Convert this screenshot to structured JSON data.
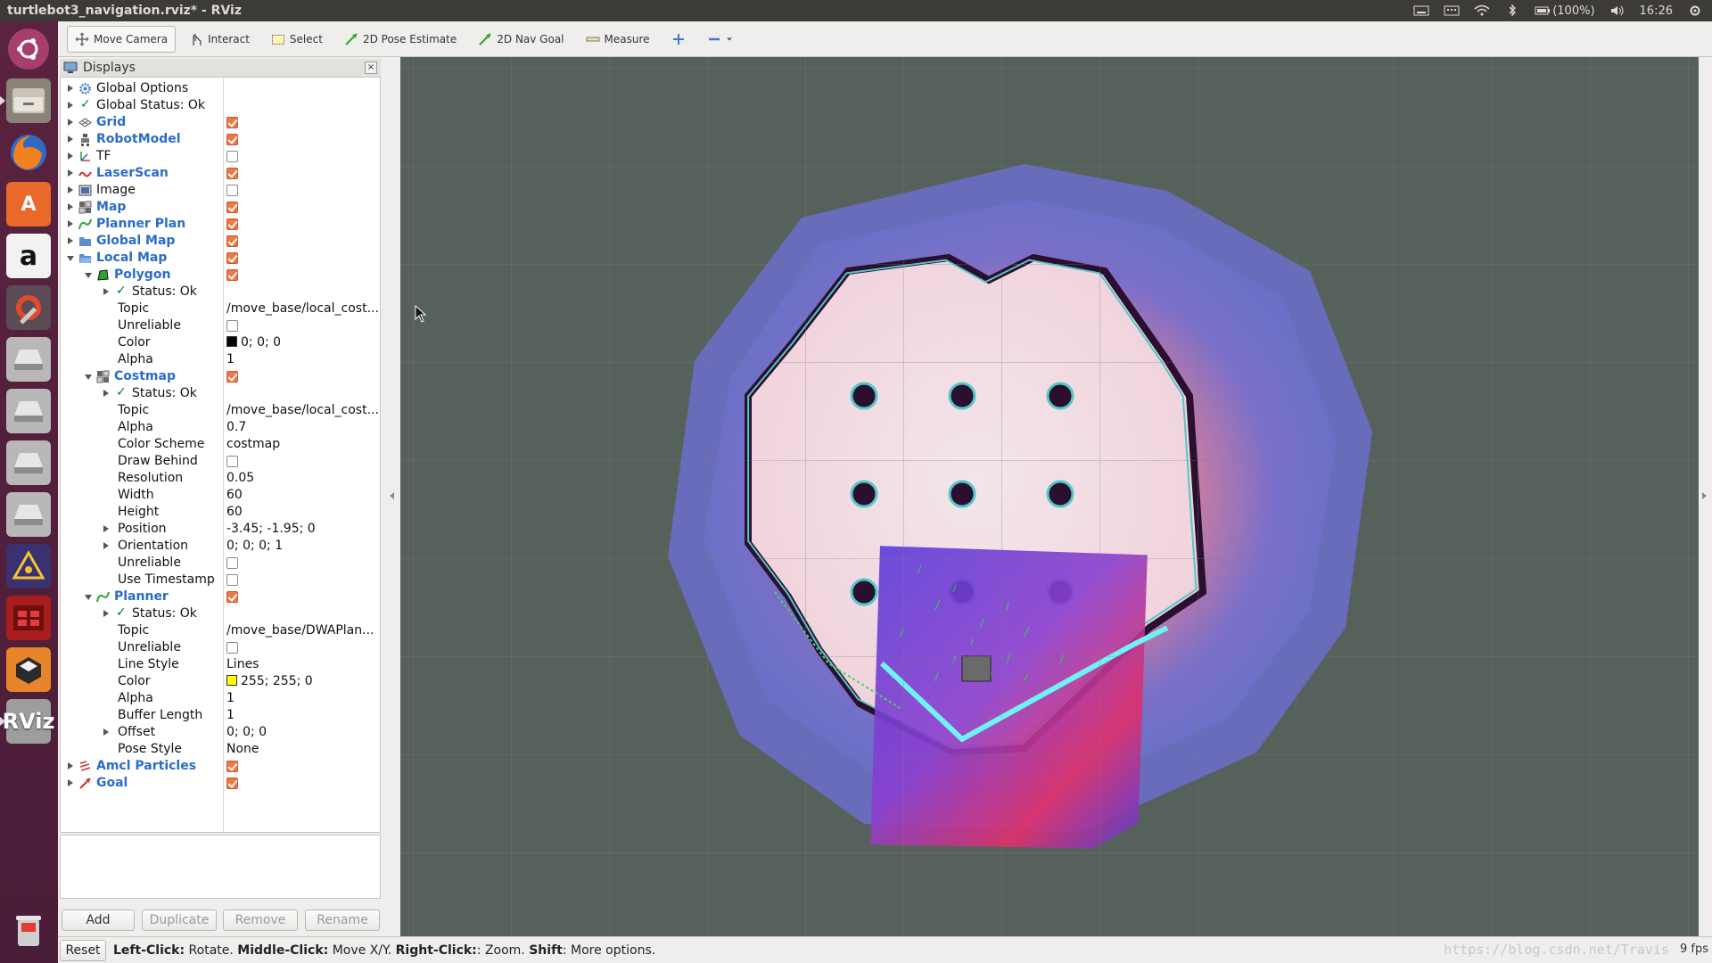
{
  "window": {
    "title": "turtlebot3_navigation.rviz* - RViz"
  },
  "tray": {
    "battery": "(100%)",
    "time": "16:26"
  },
  "toolbar": {
    "move_camera": "Move Camera",
    "interact": "Interact",
    "select": "Select",
    "pose_estimate": "2D Pose Estimate",
    "nav_goal": "2D Nav Goal",
    "measure": "Measure"
  },
  "displays": {
    "title": "Displays",
    "close": "×",
    "rows": {
      "global_options": "Global Options",
      "global_status": "Global Status: Ok",
      "grid": "Grid",
      "robot_model": "RobotModel",
      "tf": "TF",
      "laser_scan": "LaserScan",
      "image": "Image",
      "map": "Map",
      "planner_plan": "Planner Plan",
      "global_map": "Global Map",
      "local_map": "Local Map",
      "polygon": "Polygon",
      "status_ok": "Status: Ok",
      "topic": "Topic",
      "unreliable": "Unreliable",
      "color": "Color",
      "alpha": "Alpha",
      "costmap": "Costmap",
      "color_scheme": "Color Scheme",
      "draw_behind": "Draw Behind",
      "resolution": "Resolution",
      "width": "Width",
      "height": "Height",
      "position": "Position",
      "orientation": "Orientation",
      "use_timestamp": "Use Timestamp",
      "planner": "Planner",
      "line_style": "Line Style",
      "buffer_length": "Buffer Length",
      "offset": "Offset",
      "pose_style": "Pose Style",
      "amcl_particles": "Amcl Particles",
      "goal": "Goal"
    },
    "values": {
      "polygon_topic": "/move_base/local_cost...",
      "polygon_color": "0; 0; 0",
      "polygon_alpha": "1",
      "costmap_topic": "/move_base/local_cost...",
      "costmap_alpha": "0.7",
      "costmap_scheme": "costmap",
      "costmap_resolution": "0.05",
      "costmap_width": "60",
      "costmap_height": "60",
      "costmap_position": "-3.45; -1.95; 0",
      "costmap_orientation": "0; 0; 0; 1",
      "planner_topic": "/move_base/DWAPlan...",
      "planner_line_style": "Lines",
      "planner_color": "255; 255; 0",
      "planner_alpha": "1",
      "planner_buffer": "1",
      "planner_offset": "0; 0; 0",
      "planner_pose_style": "None"
    },
    "checkboxes": {
      "grid": true,
      "robot_model": true,
      "tf": false,
      "laser_scan": true,
      "image": false,
      "map": true,
      "planner_plan": true,
      "global_map": true,
      "local_map": true,
      "polygon": true,
      "polygon_unreliable": false,
      "costmap": true,
      "draw_behind": false,
      "costmap_unreliable": false,
      "use_timestamp": false,
      "planner": true,
      "planner_unreliable": false,
      "amcl_particles": true,
      "goal": true
    },
    "buttons": {
      "add": "Add",
      "duplicate": "Duplicate",
      "remove": "Remove",
      "rename": "Rename"
    }
  },
  "statusbar": {
    "reset": "Reset",
    "left_click": "Left-Click:",
    "left_action": " Rotate. ",
    "middle_click": "Middle-Click:",
    "middle_action": " Move X/Y. ",
    "right_click": "Right-Click:",
    "right_action": ": Zoom. ",
    "shift": "Shift",
    "shift_action": ": More options.",
    "watermark": "https://blog.csdn.net/Travis",
    "fps": "9 fps"
  },
  "colors": {
    "viewport_bg": "#56615c",
    "launcher": "#4a1d38",
    "checkbox_on": "#f07746",
    "display_blue": "#2a6cc9",
    "polygon_color": "#000000",
    "planner_color": "#ffff00"
  },
  "launcher_icons": [
    "ubuntu-dash-icon",
    "files-icon",
    "firefox-icon",
    "software-center-icon",
    "amazon-icon",
    "system-settings-icon",
    "drive-icon",
    "drive-icon",
    "drive-icon",
    "drive-icon",
    "unity-icon",
    "workspace-icon",
    "virtualbox-icon",
    "rviz-icon",
    "trash-icon"
  ]
}
